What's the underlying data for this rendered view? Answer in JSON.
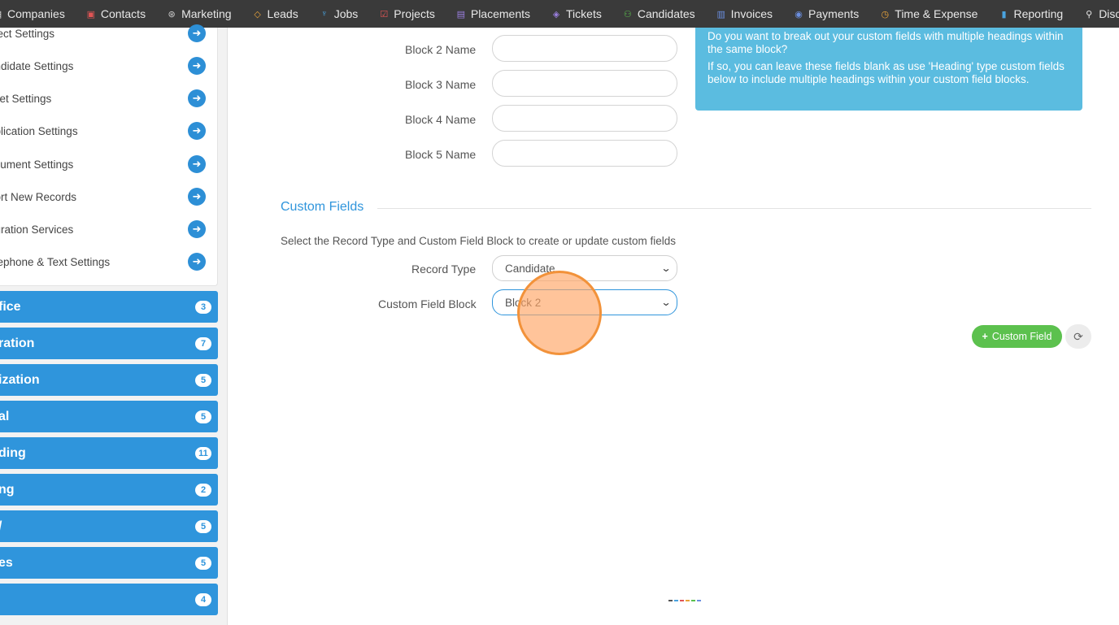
{
  "topnav": {
    "items": [
      {
        "label": "Companies",
        "icon": "building-icon",
        "color": "#e8e8e8"
      },
      {
        "label": "Contacts",
        "icon": "contact-card-icon",
        "color": "#e05555"
      },
      {
        "label": "Marketing",
        "icon": "broadcast-icon",
        "color": "#cccccc"
      },
      {
        "label": "Leads",
        "icon": "diamond-icon",
        "color": "#e8a33a"
      },
      {
        "label": "Jobs",
        "icon": "trophy-icon",
        "color": "#4aa3df"
      },
      {
        "label": "Projects",
        "icon": "checkbox-icon",
        "color": "#e05555"
      },
      {
        "label": "Placements",
        "icon": "briefcase-icon",
        "color": "#9b7fe0"
      },
      {
        "label": "Tickets",
        "icon": "tag-icon",
        "color": "#9b7fe0"
      },
      {
        "label": "Candidates",
        "icon": "users-icon",
        "color": "#5cc14e"
      },
      {
        "label": "Invoices",
        "icon": "document-icon",
        "color": "#6b8fe0"
      },
      {
        "label": "Payments",
        "icon": "coin-icon",
        "color": "#6b8fe0"
      },
      {
        "label": "Time & Expense",
        "icon": "clock-icon",
        "color": "#e8a33a"
      },
      {
        "label": "Reporting",
        "icon": "bar-chart-icon",
        "color": "#4aa3df"
      },
      {
        "label": "Discover",
        "icon": "search-icon",
        "color": "#e8e8e8"
      }
    ]
  },
  "sidebar": {
    "settings": [
      {
        "label": "oject Settings"
      },
      {
        "label": "andidate Settings"
      },
      {
        "label": "cket Settings"
      },
      {
        "label": "pplication Settings"
      },
      {
        "label": "ocument Settings"
      },
      {
        "label": "port New Records"
      },
      {
        "label": "egration Services"
      },
      {
        "label": "elephone & Text Settings"
      }
    ],
    "categories": [
      {
        "label": "fice",
        "count": "3"
      },
      {
        "label": "ration",
        "count": "7"
      },
      {
        "label": "ization",
        "count": "5"
      },
      {
        "label": "al",
        "count": "5"
      },
      {
        "label": "ding",
        "count": "11"
      },
      {
        "label": "ng",
        "count": "2"
      },
      {
        "label": "/",
        "count": "5"
      },
      {
        "label": "es",
        "count": "5"
      },
      {
        "label": "",
        "count": "4"
      }
    ]
  },
  "blocks": [
    {
      "label": "Block 2 Name",
      "value": ""
    },
    {
      "label": "Block 3 Name",
      "value": ""
    },
    {
      "label": "Block 4 Name",
      "value": ""
    },
    {
      "label": "Block 5 Name",
      "value": ""
    }
  ],
  "info": {
    "line1": "Do you want to break out your custom fields with multiple headings within the same block?",
    "line2": "If so, you can leave these fields blank as use 'Heading' type custom fields below to include multiple headings within your custom field blocks."
  },
  "custom_fields": {
    "title": "Custom Fields",
    "description": "Select the Record Type and Custom Field Block to create or update custom fields",
    "record_type_label": "Record Type",
    "record_type_value": "Candidate",
    "block_label": "Custom Field Block",
    "block_value": "Block 2",
    "add_button": "Custom Field"
  },
  "colors": {
    "accent": "#2f95dc",
    "success": "#5cc14e",
    "info": "#5bbce0",
    "click_marker": "#f2923a"
  }
}
